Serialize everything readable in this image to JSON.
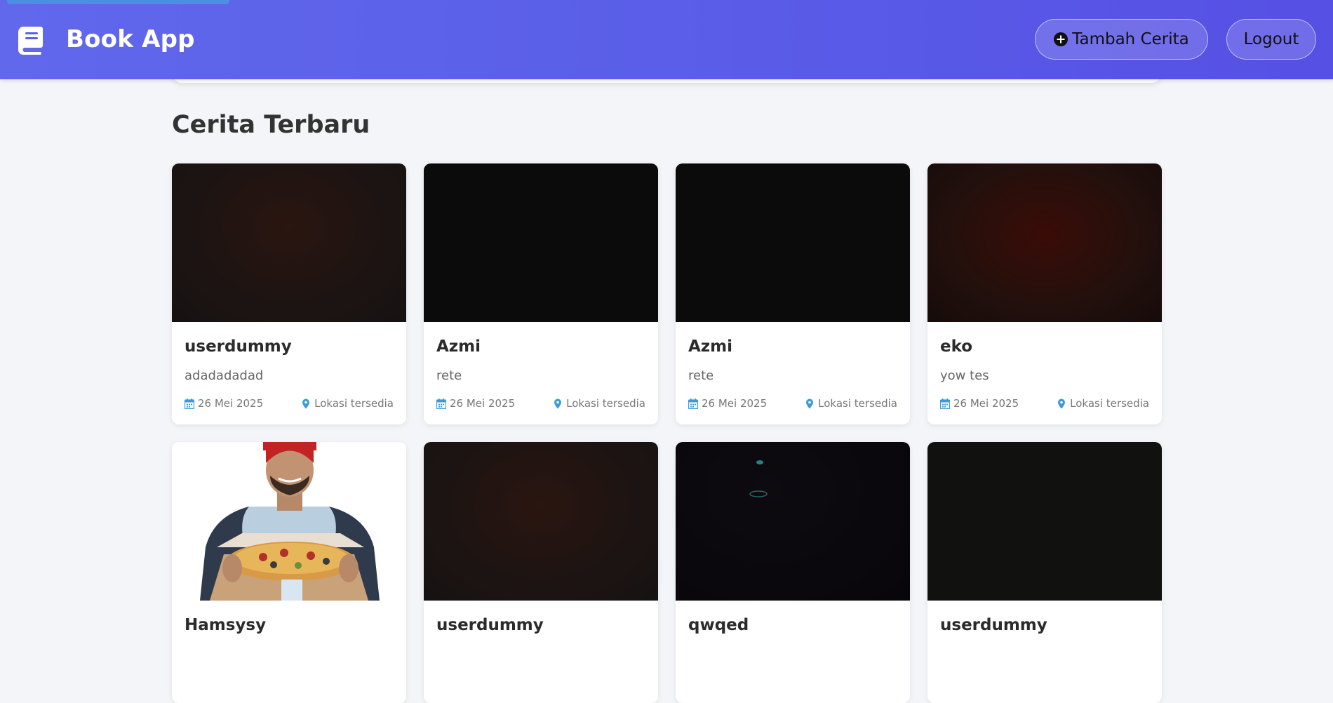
{
  "header": {
    "app_title": "Book App",
    "brand_icon": "book-icon",
    "add_story_label": "Tambah Cerita",
    "add_icon": "plus-circle-icon",
    "logout_label": "Logout",
    "accent": "#5a5ee8"
  },
  "main": {
    "section_title": "Cerita Terbaru",
    "stories": [
      {
        "name": "userdummy",
        "description": "adadadadad",
        "date": "26 Mei 2025",
        "location": "Lokasi tersedia"
      },
      {
        "name": "Azmi",
        "description": "rete",
        "date": "26 Mei 2025",
        "location": "Lokasi tersedia"
      },
      {
        "name": "Azmi",
        "description": "rete",
        "date": "26 Mei 2025",
        "location": "Lokasi tersedia"
      },
      {
        "name": "eko",
        "description": "yow tes",
        "date": "26 Mei 2025",
        "location": "Lokasi tersedia"
      },
      {
        "name": "Hamsysy"
      },
      {
        "name": "userdummy"
      },
      {
        "name": "qwqed"
      },
      {
        "name": "userdummy"
      }
    ],
    "meta_icons": {
      "date": "calendar-icon",
      "location": "map-pin-icon"
    },
    "meta_icon_color": "#3b9ad9"
  }
}
